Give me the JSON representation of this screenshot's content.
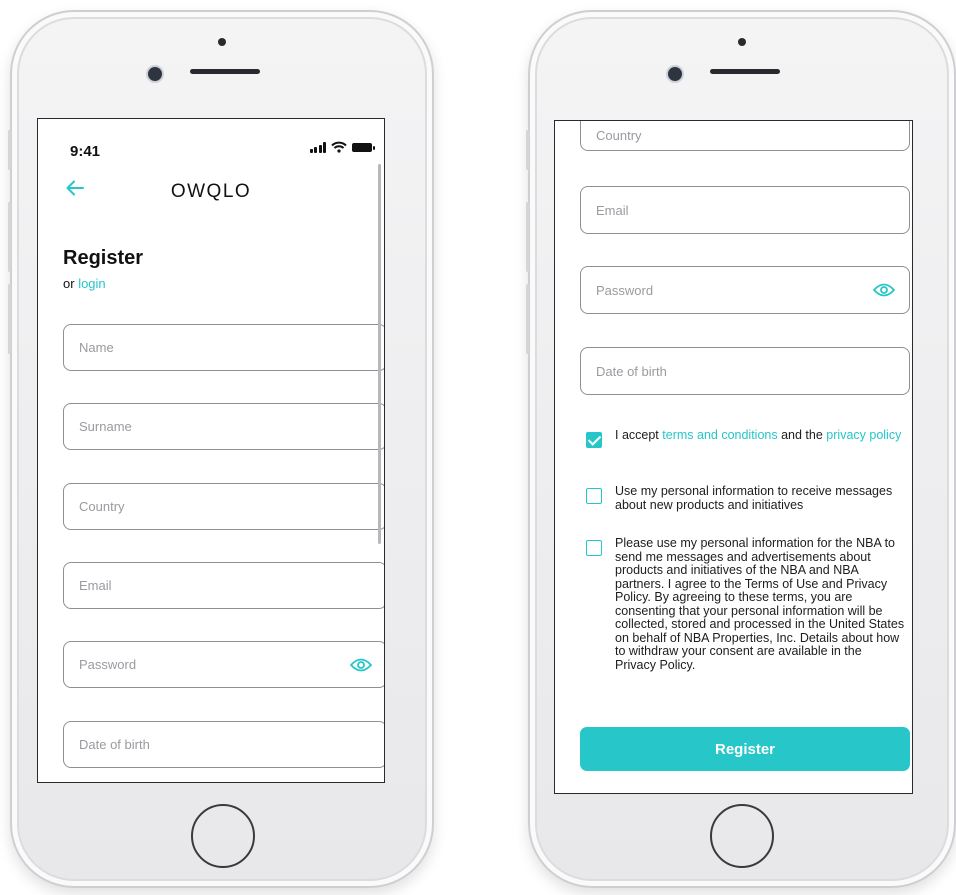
{
  "left_screen": {
    "status": {
      "time": "9:41"
    },
    "header": {
      "logo": "OWQLO"
    },
    "title": "Register",
    "or_prefix": "or",
    "login_link": "login",
    "fields": {
      "name": "Name",
      "surname": "Surname",
      "country": "Country",
      "email": "Email",
      "password": "Password",
      "date_of_birth": "Date of birth"
    }
  },
  "right_screen": {
    "fields": {
      "country": "Country",
      "email": "Email",
      "password": "Password",
      "date_of_birth": "Date of birth"
    },
    "checks": {
      "terms": {
        "checked": true,
        "prefix": "I accept",
        "terms_link": "terms and conditions",
        "middle": "and the",
        "privacy_link": "privacy policy"
      },
      "marketing": {
        "checked": false,
        "text": "Use my personal information to receive messages about new products and initiatives"
      },
      "nba": {
        "checked": false,
        "text": "Please use my personal information for the NBA to send me messages and advertisements about products and initiatives of the NBA and NBA partners. I agree to the Terms of Use and Privacy Policy. By agreeing to these terms, you are consenting that your personal information will be collected, stored and processed in the United States on behalf of NBA Properties, Inc. Details about how to withdraw your consent are available in the Privacy Policy."
      }
    },
    "register_label": "Register"
  },
  "icons": {
    "back": "arrow-left-icon",
    "eye": "eye-icon",
    "signal": "cellular-signal-icon",
    "wifi": "wifi-icon",
    "battery": "battery-icon"
  },
  "colors": {
    "accent": "#26c6c9",
    "text": "#1d1d1f",
    "placeholder": "#9a9aa0",
    "field_border": "#8f8f94"
  }
}
